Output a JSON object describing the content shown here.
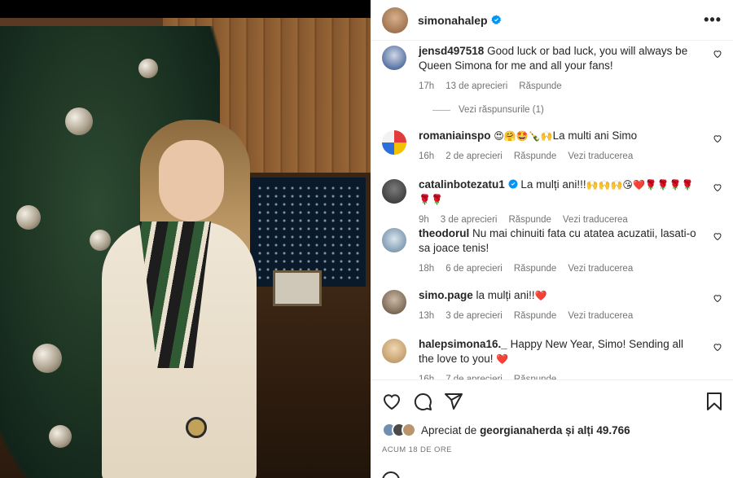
{
  "post": {
    "author": "simonahalep",
    "more_label": "•••"
  },
  "comments": [
    {
      "user": "jensd497518",
      "text": "Good luck or bad luck, you will always be Queen Simona for me and all your fans!",
      "time": "17h",
      "likes": "13 de aprecieri",
      "reply": "Răspunde",
      "replies_toggle": "Vezi răspunsurile (1)"
    },
    {
      "user": "romaniainspo",
      "text": "La multi ani Simo",
      "emoji": "😍🤗🤩🍾🙌",
      "time": "16h",
      "likes": "2 de aprecieri",
      "reply": "Răspunde",
      "translate": "Vezi traducerea"
    },
    {
      "user": "catalinbotezatu1",
      "text": "La mulți ani!!!",
      "emoji": "🙌🙌🙌😘❤️🌹🌹🌹🌹🌹🌹",
      "time": "9h",
      "likes": "3 de aprecieri",
      "reply": "Răspunde",
      "translate": "Vezi traducerea"
    },
    {
      "user": "theodorul",
      "text": "Nu mai chinuiti fata cu atatea acuzatii, lasati-o sa joace tenis!",
      "time": "18h",
      "likes": "6 de aprecieri",
      "reply": "Răspunde",
      "translate": "Vezi traducerea"
    },
    {
      "user": "simo.page",
      "text": "la mulți ani!!",
      "emoji": "❤️",
      "time": "13h",
      "likes": "3 de aprecieri",
      "reply": "Răspunde",
      "translate": "Vezi traducerea"
    },
    {
      "user": "halepsimona16._",
      "text": "Happy New Year, Simo! Sending all the love to you!",
      "emoji": "❤️",
      "time": "16h",
      "likes": "7 de aprecieri",
      "reply": "Răspunde"
    }
  ],
  "likes_summary": {
    "prefix": "Apreciat de",
    "user": "georgianaherda",
    "suffix": "și alți 49.766"
  },
  "timestamp": "Acum 18 de ore",
  "colors": {
    "verified": "#0095f6",
    "heart": "#ed4956",
    "meta": "#737373"
  }
}
